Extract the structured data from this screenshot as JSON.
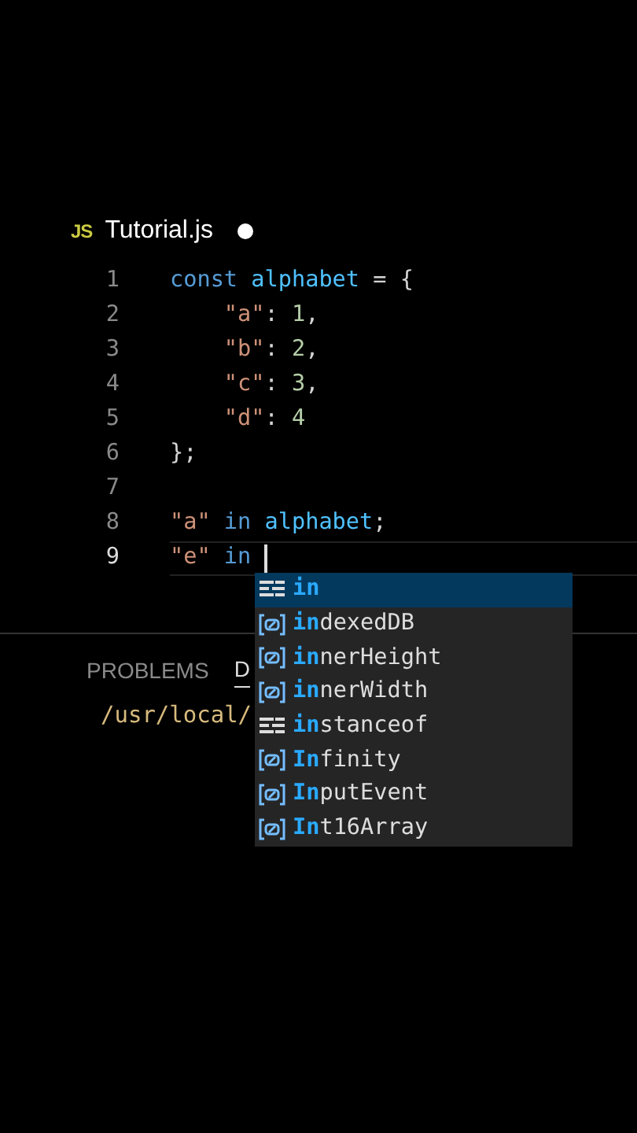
{
  "tab": {
    "icon_text": "JS",
    "title": "Tutorial.js",
    "modified": true
  },
  "editor": {
    "lines": [
      {
        "number": "1",
        "tokens": [
          {
            "kind": "keyword",
            "text": "const "
          },
          {
            "kind": "variable",
            "text": "alphabet"
          },
          {
            "kind": "punct",
            "text": " = {"
          }
        ]
      },
      {
        "number": "2",
        "indent": true,
        "tokens": [
          {
            "kind": "string",
            "text": "\"a\""
          },
          {
            "kind": "punct",
            "text": ": "
          },
          {
            "kind": "number",
            "text": "1"
          },
          {
            "kind": "punct",
            "text": ","
          }
        ]
      },
      {
        "number": "3",
        "indent": true,
        "tokens": [
          {
            "kind": "string",
            "text": "\"b\""
          },
          {
            "kind": "punct",
            "text": ": "
          },
          {
            "kind": "number",
            "text": "2"
          },
          {
            "kind": "punct",
            "text": ","
          }
        ]
      },
      {
        "number": "4",
        "indent": true,
        "tokens": [
          {
            "kind": "string",
            "text": "\"c\""
          },
          {
            "kind": "punct",
            "text": ": "
          },
          {
            "kind": "number",
            "text": "3"
          },
          {
            "kind": "punct",
            "text": ","
          }
        ]
      },
      {
        "number": "5",
        "indent": true,
        "tokens": [
          {
            "kind": "string",
            "text": "\"d\""
          },
          {
            "kind": "punct",
            "text": ": "
          },
          {
            "kind": "number",
            "text": "4"
          }
        ]
      },
      {
        "number": "6",
        "tokens": [
          {
            "kind": "punct",
            "text": "};"
          }
        ]
      },
      {
        "number": "7"
      },
      {
        "number": "8",
        "tokens": [
          {
            "kind": "string",
            "text": "\"a\""
          },
          {
            "kind": "keyword",
            "text": " in "
          },
          {
            "kind": "variable",
            "text": "alphabet"
          },
          {
            "kind": "punct",
            "text": ";"
          }
        ]
      },
      {
        "number": "9",
        "current": true,
        "tokens": [
          {
            "kind": "string",
            "text": "\"e\""
          },
          {
            "kind": "keyword",
            "text": " in "
          }
        ]
      }
    ]
  },
  "suggestions": [
    {
      "kind": "keyword",
      "match": "in",
      "selected": true
    },
    {
      "kind": "variable",
      "match": "in",
      "rest": "dexedDB",
      "selected": false
    },
    {
      "kind": "variable",
      "match": "in",
      "rest": "nerHeight",
      "selected": false
    },
    {
      "kind": "variable",
      "match": "in",
      "rest": "nerWidth",
      "selected": false
    },
    {
      "kind": "keyword",
      "match": "in",
      "rest": "stanceof",
      "selected": false
    },
    {
      "kind": "variable",
      "match": "In",
      "rest": "finity",
      "selected": false
    },
    {
      "kind": "variable",
      "match": "In",
      "rest": "putEvent",
      "selected": false
    },
    {
      "kind": "variable",
      "match": "In",
      "rest": "t16Array",
      "selected": false
    }
  ],
  "panel": {
    "tabs": [
      {
        "label": "PROBLEMS",
        "selected": false
      },
      {
        "label": "D",
        "selected": true
      }
    ],
    "output": "/usr/local/"
  }
}
